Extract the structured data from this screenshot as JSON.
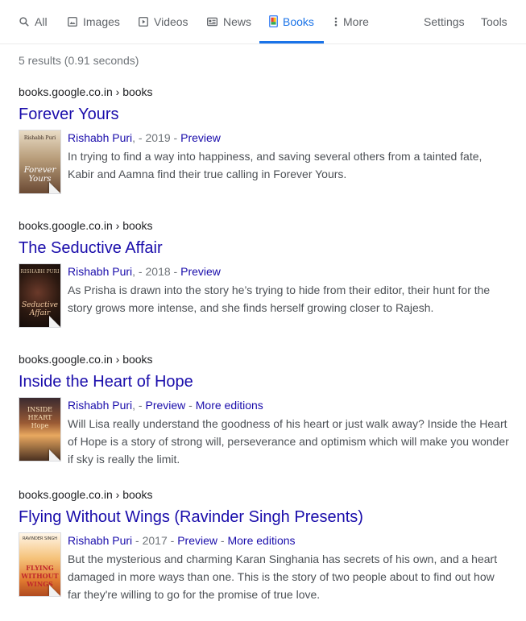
{
  "tabs": [
    {
      "label": "All",
      "icon": "search-icon"
    },
    {
      "label": "Images",
      "icon": "image-icon"
    },
    {
      "label": "Videos",
      "icon": "video-play-icon"
    },
    {
      "label": "News",
      "icon": "news-icon"
    },
    {
      "label": "Books",
      "icon": "book-icon"
    },
    {
      "label": "More",
      "icon": "more-dots-icon"
    },
    {
      "label": "Settings"
    },
    {
      "label": "Tools"
    }
  ],
  "active_tab": "Books",
  "result_stats": "5 results (0.91 seconds)",
  "results": [
    {
      "cite": "books.google.co.in › books",
      "title": "Forever Yours",
      "author": "Rishabh Puri",
      "year": "2019",
      "preview": "Preview",
      "more_editions": "",
      "snippet": "In trying to find a way into happiness, and saving several others from a tainted fate, Kabir and Aamna find their true calling in Forever Yours.",
      "cover": {
        "author": "Rishabh Puri",
        "title": "Forever Yours",
        "bg": "#c9b89b",
        "fg": "#ffffff"
      }
    },
    {
      "cite": "books.google.co.in › books",
      "title": "The Seductive Affair",
      "author": "Rishabh Puri",
      "year": "2018",
      "preview": "Preview",
      "more_editions": "",
      "snippet": "As Prisha is drawn into the story he’s trying to hide from their editor, their hunt for the story grows more intense, and she finds herself growing closer to Rajesh.",
      "cover": {
        "author": "RISHABH PURI",
        "title": "Seductive Affair",
        "bg": "#2a1a14",
        "fg": "#e8c7a0"
      }
    },
    {
      "cite": "books.google.co.in › books",
      "title": "Inside the Heart of Hope",
      "author": "Rishabh Puri",
      "year": "",
      "preview": "Preview",
      "more_editions": "More editions",
      "snippet": "Will Lisa really understand the goodness of his heart or just walk away? Inside the Heart of Hope is a story of strong will, perseverance and optimism which will make you wonder if sky is really the limit.",
      "cover": {
        "author": "",
        "title": "INSIDE HEART Hope",
        "bg": "#7a4a2a",
        "fg": "#f5d9a8"
      }
    },
    {
      "cite": "books.google.co.in › books",
      "title": "Flying Without Wings (Ravinder Singh Presents)",
      "author": "Rishabh Puri",
      "year": "2017",
      "preview": "Preview",
      "more_editions": "More editions",
      "snippet": "But the mysterious and charming Karan Singhania has secrets of his own, and a heart damaged in more ways than one. This is the story of two people about to find out how far they're willing to go for the promise of true love.",
      "cover": {
        "author": "RAVINDER SINGH",
        "title": "FLYING WITHOUT WINGS",
        "bg": "#e8a24a",
        "fg": "#c0392b"
      }
    }
  ]
}
